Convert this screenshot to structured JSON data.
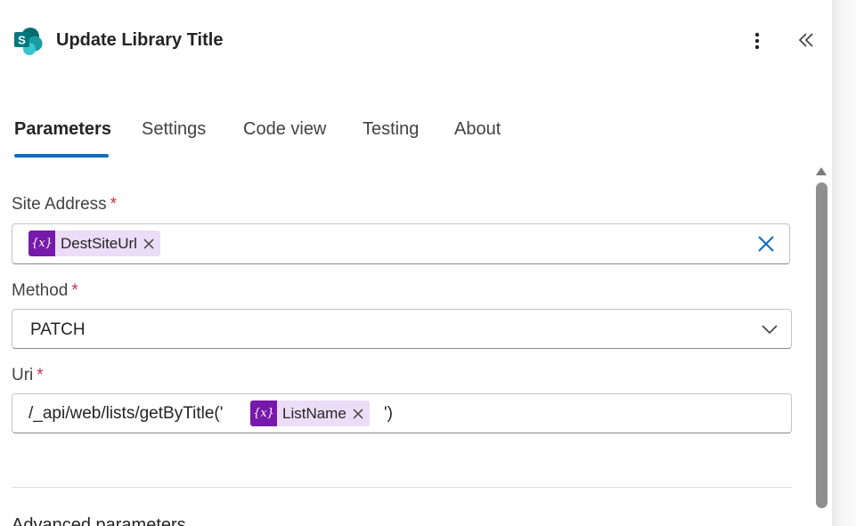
{
  "header": {
    "title": "Update Library Title",
    "logo_icon": "sharepoint-logo-icon",
    "logo_letter": "S",
    "more_icon": "more-vertical-icon",
    "collapse_icon": "double-chevron-left-icon"
  },
  "tabs": [
    {
      "label": "Parameters",
      "active": true
    },
    {
      "label": "Settings",
      "active": false
    },
    {
      "label": "Code view",
      "active": false
    },
    {
      "label": "Testing",
      "active": false
    },
    {
      "label": "About",
      "active": false
    }
  ],
  "fields": {
    "site_address": {
      "label": "Site Address",
      "required_mark": "*",
      "token": {
        "icon_text": "{x}",
        "label": "DestSiteUrl"
      }
    },
    "method": {
      "label": "Method",
      "required_mark": "*",
      "value": "PATCH"
    },
    "uri": {
      "label": "Uri",
      "required_mark": "*",
      "prefix": "/_api/web/lists/getByTitle('",
      "token": {
        "icon_text": "{x}",
        "label": "ListName"
      },
      "suffix": "')"
    }
  },
  "section": {
    "advanced_label": "Advanced parameters"
  },
  "colors": {
    "accent": "#0f6cbd",
    "token_bg": "#ecdcf6",
    "token_icon_bg": "#7719aa",
    "required": "#c4314b"
  }
}
